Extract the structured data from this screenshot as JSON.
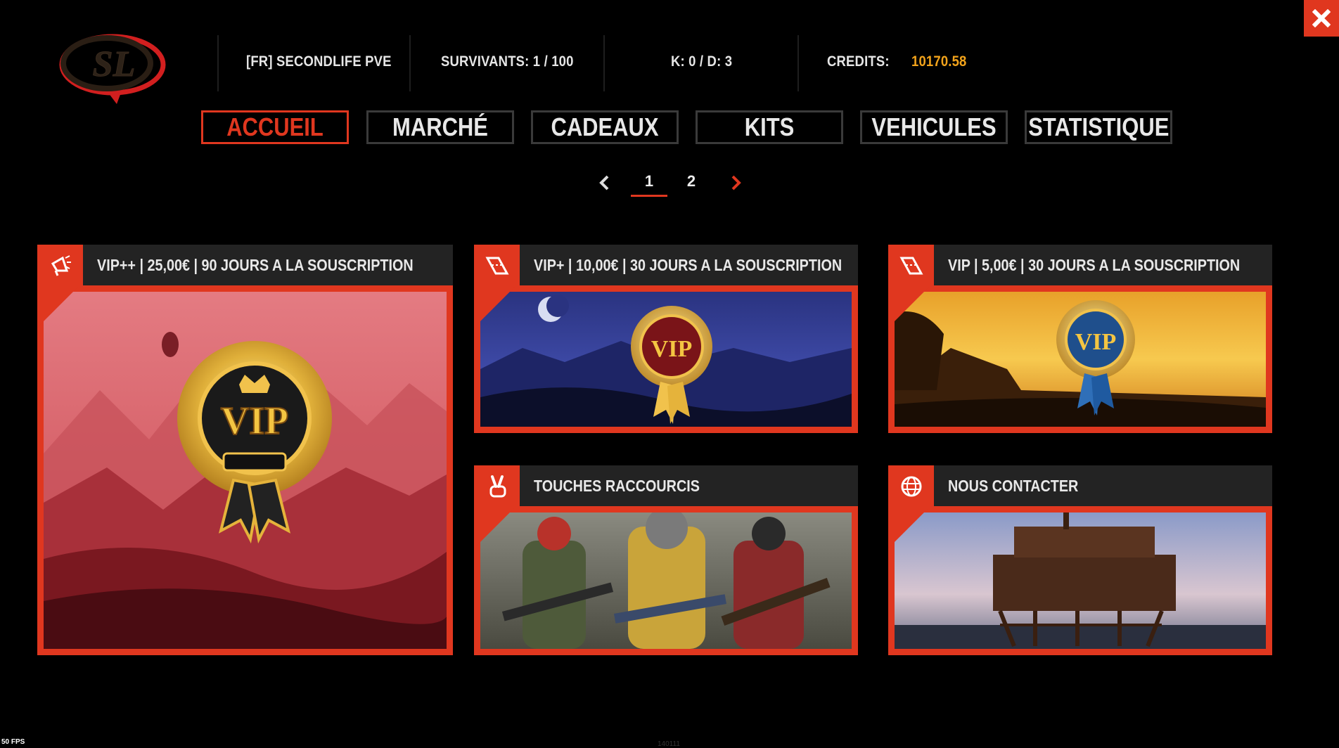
{
  "header": {
    "logo_text": "SL",
    "server": "[FR] SECONDLIFE PVE",
    "survivors": "SURVIVANTS: 1 / 100",
    "kd": "K: 0  / D: 3",
    "credits_label": "CREDITS:",
    "credits_value": "10170.58"
  },
  "nav": {
    "tabs": [
      {
        "label": "ACCUEIL",
        "active": true
      },
      {
        "label": "MARCHÉ",
        "active": false
      },
      {
        "label": "CADEAUX",
        "active": false
      },
      {
        "label": "KITS",
        "active": false
      },
      {
        "label": "VEHICULES",
        "active": false
      },
      {
        "label": "STATISTIQUE",
        "active": false
      }
    ]
  },
  "pager": {
    "pages": [
      "1",
      "2"
    ],
    "current": "1",
    "prev_icon": "chevron-left-icon",
    "next_icon": "chevron-right-icon"
  },
  "cards": [
    {
      "title": "VIP++ | 25,00€ | 90 JOURS A LA SOUSCRIPTION",
      "icon": "megaphone-icon",
      "badge_text": "VIP"
    },
    {
      "title": "VIP+ | 10,00€ | 30 JOURS A LA SOUSCRIPTION",
      "icon": "ticket-icon",
      "badge_text": "VIP"
    },
    {
      "title": "VIP | 5,00€ | 30 JOURS A LA SOUSCRIPTION",
      "icon": "ticket-icon",
      "badge_text": "VIP"
    },
    {
      "title": "TOUCHES RACCOURCIS",
      "icon": "peace-hand-icon"
    },
    {
      "title": "NOUS CONTACTER",
      "icon": "globe-icon"
    }
  ],
  "status": {
    "fps": "50 FPS",
    "build": "140111"
  },
  "colors": {
    "accent": "#e0371f",
    "credits": "#f2a31b",
    "header_bg": "#232323",
    "background": "#000000"
  }
}
